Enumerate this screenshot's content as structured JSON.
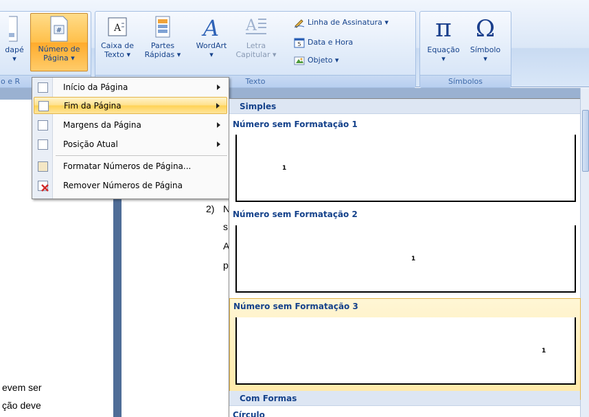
{
  "ribbon": {
    "footer_partial": "dapé",
    "page_number_line1": "Número de",
    "page_number_line2": "Página",
    "group_partial": "o e R",
    "text_box_line1": "Caixa de",
    "text_box_line2": "Texto",
    "quick_parts_line1": "Partes",
    "quick_parts_line2": "Rápidas",
    "wordart": "WordArt",
    "drop_cap_line1": "Letra",
    "drop_cap_line2": "Capitular",
    "signature_line": "Linha de Assinatura",
    "date_time": "Data e Hora",
    "object": "Objeto",
    "group_text": "Texto",
    "equation": "Equação",
    "symbol": "Símbolo",
    "group_symbols": "Símbolos",
    "pi_glyph": "π",
    "omega_glyph": "Ω"
  },
  "menu": {
    "items": [
      {
        "label": "Início da Página",
        "submenu": true
      },
      {
        "label": "Fim da Página",
        "submenu": true
      },
      {
        "label": "Margens da Página",
        "submenu": true
      },
      {
        "label": "Posição Atual",
        "submenu": true
      },
      {
        "label": "Formatar Números de Página...",
        "submenu": false
      },
      {
        "label": "Remover Números de Página",
        "submenu": false
      }
    ]
  },
  "gallery": {
    "section1": "Simples",
    "items": [
      {
        "title": "Número sem Formatação 1",
        "number": "1"
      },
      {
        "title": "Número sem Formatação 2",
        "number": "1"
      },
      {
        "title": "Número sem Formatação 3",
        "number": "1"
      }
    ],
    "section2": "Com Formas",
    "next_item": "Círculo"
  },
  "document": {
    "numbered": "2)",
    "frag1": "N",
    "frag2": "s",
    "frag3": "A",
    "frag4": "p",
    "line_a": "evem ser",
    "line_b": "ção deve"
  },
  "colors": {
    "ribbon_text": "#15428b",
    "highlight": "#ffd254",
    "doc_bg": "#9ab1d1"
  }
}
